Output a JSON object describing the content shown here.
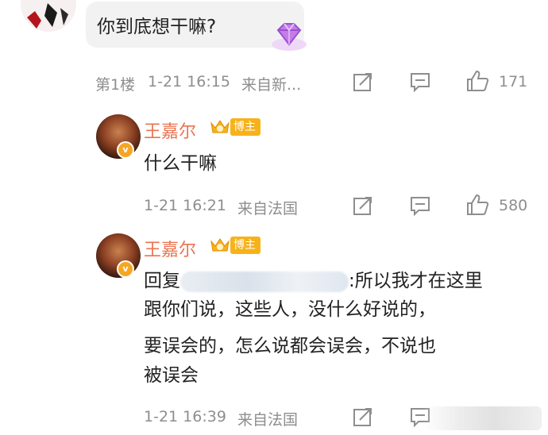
{
  "top_comment": {
    "text": "你到底想干嘛?",
    "floor": "第1楼",
    "time": "1-21 16:15",
    "source": "来自新...",
    "likes": "171"
  },
  "replies": [
    {
      "username": "王嘉尔",
      "badge": "博主",
      "text": "什么干嘛",
      "time": "1-21 16:21",
      "source": "来自法国",
      "likes": "580"
    },
    {
      "username": "王嘉尔",
      "badge": "博主",
      "reply_prefix": "回复",
      "line1_suffix": ":所以我才在这里",
      "line2": "跟你们说，这些人，没什么好说的，",
      "line3": "要误会的，怎么说都会误会，不说也",
      "line4": "被误会",
      "time": "1-21 16:39",
      "source": "来自法国"
    }
  ],
  "colors": {
    "username": "#eb7350",
    "meta": "#8e8e8e",
    "badge": "#f7b21b",
    "bubble": "#f2f2f2"
  },
  "icons": [
    "share-icon",
    "comment-icon",
    "like-icon",
    "crown-icon",
    "gem-icon",
    "verified-icon"
  ]
}
